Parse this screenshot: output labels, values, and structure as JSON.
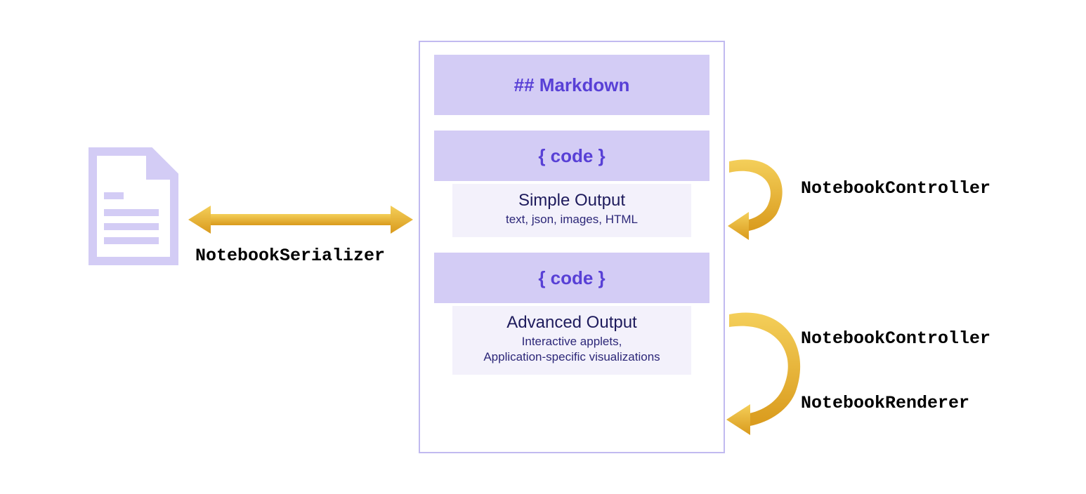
{
  "notebook": {
    "markdown_cell_label": "## Markdown",
    "code_cell_label_1": "{ code }",
    "simple_output_title": "Simple Output",
    "simple_output_sub": "text, json, images, HTML",
    "code_cell_label_2": "{ code }",
    "advanced_output_title": "Advanced Output",
    "advanced_output_sub_line1": "Interactive applets,",
    "advanced_output_sub_line2": "Application-specific visualizations"
  },
  "labels": {
    "serializer": "NotebookSerializer",
    "controller_top": "NotebookController",
    "controller_bottom": "NotebookController",
    "renderer": "NotebookRenderer"
  },
  "colors": {
    "lavender_light": "#d3ccf5",
    "lavender_border": "#c1baf0",
    "purple_text": "#5840d6",
    "dark_navy_text": "#1e1b5c",
    "arrow_gold": "#e8b62f",
    "output_bg": "#f3f1fb"
  }
}
